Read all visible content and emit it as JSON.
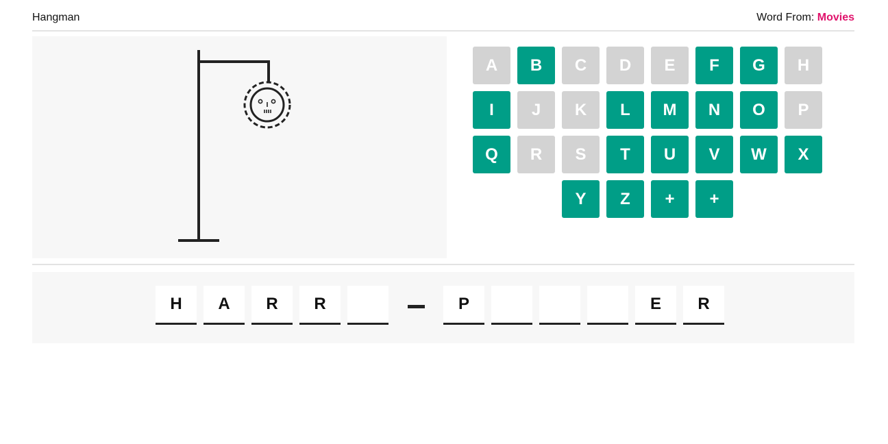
{
  "header": {
    "title": "Hangman",
    "category_label": "Word From:",
    "category_value": "Movies"
  },
  "colors": {
    "available_key": "#009e87",
    "used_key": "#d3d3d3",
    "category_accent": "#e0136c"
  },
  "hangman": {
    "parts_drawn": [
      "gallows",
      "head"
    ]
  },
  "keyboard": {
    "keys": [
      {
        "label": "A",
        "state": "used"
      },
      {
        "label": "B",
        "state": "available"
      },
      {
        "label": "C",
        "state": "used"
      },
      {
        "label": "D",
        "state": "used"
      },
      {
        "label": "E",
        "state": "used"
      },
      {
        "label": "F",
        "state": "available"
      },
      {
        "label": "G",
        "state": "available"
      },
      {
        "label": "H",
        "state": "used"
      },
      {
        "label": "I",
        "state": "available"
      },
      {
        "label": "J",
        "state": "used"
      },
      {
        "label": "K",
        "state": "used"
      },
      {
        "label": "L",
        "state": "available"
      },
      {
        "label": "M",
        "state": "available"
      },
      {
        "label": "N",
        "state": "available"
      },
      {
        "label": "O",
        "state": "available"
      },
      {
        "label": "P",
        "state": "used"
      },
      {
        "label": "Q",
        "state": "available"
      },
      {
        "label": "R",
        "state": "used"
      },
      {
        "label": "S",
        "state": "used"
      },
      {
        "label": "T",
        "state": "available"
      },
      {
        "label": "U",
        "state": "available"
      },
      {
        "label": "V",
        "state": "available"
      },
      {
        "label": "W",
        "state": "available"
      },
      {
        "label": "X",
        "state": "available"
      },
      {
        "label": "Y",
        "state": "available"
      },
      {
        "label": "Z",
        "state": "available"
      },
      {
        "label": "+",
        "state": "available"
      },
      {
        "label": "+",
        "state": "available"
      }
    ]
  },
  "word": {
    "slots": [
      "H",
      "A",
      "R",
      "R",
      "",
      " ",
      "P",
      "",
      "",
      "",
      "E",
      "R"
    ]
  }
}
